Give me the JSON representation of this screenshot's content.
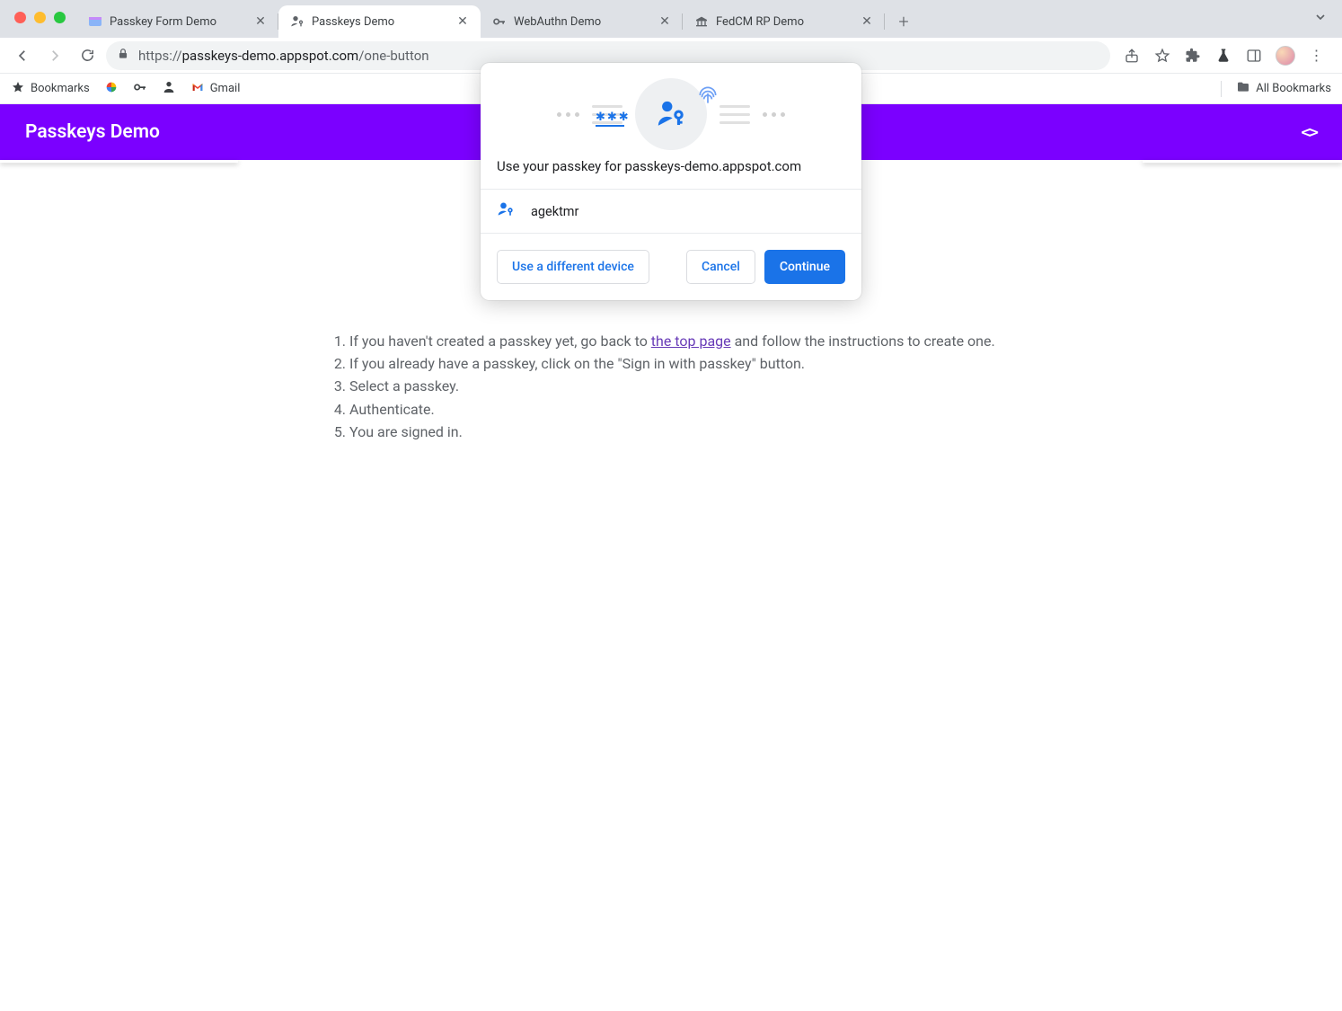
{
  "browser": {
    "tabs": [
      {
        "title": "Passkey Form Demo",
        "favicon": "form",
        "active": false
      },
      {
        "title": "Passkeys Demo",
        "favicon": "passkey",
        "active": true
      },
      {
        "title": "WebAuthn Demo",
        "favicon": "key",
        "active": false
      },
      {
        "title": "FedCM RP Demo",
        "favicon": "bank",
        "active": false
      }
    ],
    "url_scheme": "https://",
    "url_host": "passkeys-demo.appspot.com",
    "url_path": "/one-button",
    "bookmarks_label": "Bookmarks",
    "gmail_label": "Gmail",
    "all_bookmarks_label": "All Bookmarks"
  },
  "app": {
    "title": "Passkeys Demo"
  },
  "instructions": {
    "step1_prefix": "If you haven't created a passkey yet, go back to ",
    "step1_link": "the top page",
    "step1_suffix": " and follow the instructions to create one.",
    "step2": "If you already have a passkey, click on the \"Sign in with passkey\" button.",
    "step3": "Select a passkey.",
    "step4": "Authenticate.",
    "step5": "You are signed in."
  },
  "dialog": {
    "title": "Use your passkey for passkeys-demo.appspot.com",
    "account": "agektmr",
    "different_device_label": "Use a different device",
    "cancel_label": "Cancel",
    "continue_label": "Continue"
  }
}
